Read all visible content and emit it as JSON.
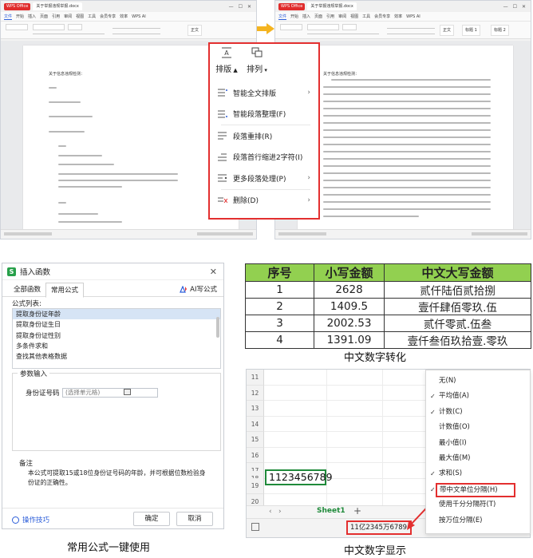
{
  "writer": {
    "app_logo": "WPS Office",
    "tab_label": "关于举报违规举报.docx",
    "menus": [
      "文件",
      "开始",
      "插入",
      "页面",
      "引用",
      "审阅",
      "视图",
      "工具",
      "会员专享",
      "效率",
      "WPS AI"
    ],
    "style_chips": [
      "正文",
      "标题 1",
      "标题 2"
    ],
    "doc_heading_left": "关于信息违规检测：",
    "doc_heading_right": "关于信息违规检测："
  },
  "format_popup": {
    "tool_layout": "排版",
    "tool_arrange": "排列",
    "items": [
      {
        "label": "智能全文排版",
        "icon": "smart-layout-icon",
        "submenu": true
      },
      {
        "label": "智能段落整理(F)",
        "icon": "smart-paragraph-icon",
        "submenu": false
      },
      {
        "label": "段落重排(R)",
        "icon": "paragraph-reflow-icon",
        "submenu": false
      },
      {
        "label": "段落首行缩进2字符(I)",
        "icon": "indent-icon",
        "submenu": false
      },
      {
        "label": "更多段落处理(P)",
        "icon": "more-paragraph-icon",
        "submenu": true
      },
      {
        "label": "删除(D)",
        "icon": "delete-icon",
        "submenu": true
      }
    ],
    "border_color": "#e32f2f"
  },
  "insert_function": {
    "title": "插入函数",
    "tabs": [
      "全部函数",
      "常用公式"
    ],
    "active_tab": "常用公式",
    "ai_button": "AI写公式",
    "list_label": "公式列表:",
    "formulas": [
      "提取身份证年龄",
      "提取身份证生日",
      "提取身份证性别",
      "多条件求和",
      "查找其他表格数据"
    ],
    "selected_formula": "提取身份证年龄",
    "params_label": "参数输入",
    "id_field_label": "身份证号码",
    "id_field_placeholder": "(选择单元格)",
    "note_title": "备注",
    "note_body": "本公式可提取15或18位身份证号码的年龄，并可根据位数检验身份证的正确性。",
    "tips_label": "操作技巧",
    "ok_label": "确定",
    "cancel_label": "取消",
    "caption": "常用公式一键使用"
  },
  "number_table": {
    "headers": [
      "序号",
      "小写金额",
      "中文大写金额"
    ],
    "rows": [
      [
        "1",
        "2628",
        "贰仟陆佰贰拾捌"
      ],
      [
        "2",
        "1409.5",
        "壹仟肆佰零玖.伍"
      ],
      [
        "3",
        "2002.53",
        "贰仟零贰.伍叁"
      ],
      [
        "4",
        "1391.09",
        "壹仟叁佰玖拾壹.零玖"
      ]
    ],
    "header_bg": "#92d050",
    "caption": "中文数字转化"
  },
  "spreadsheet": {
    "row_numbers": [
      "11",
      "12",
      "13",
      "14",
      "15",
      "16",
      "17",
      "18",
      "19",
      "20",
      "21"
    ],
    "cell_value": "1123456789",
    "sheet_tab": "Sheet1",
    "status_value": "11亿2345万6789",
    "context_menu": [
      {
        "label": "无(N)",
        "checked": false
      },
      {
        "label": "平均值(A)",
        "checked": true
      },
      {
        "label": "计数(C)",
        "checked": true
      },
      {
        "label": "计数值(O)",
        "checked": false
      },
      {
        "label": "最小值(I)",
        "checked": false
      },
      {
        "label": "最大值(M)",
        "checked": false
      },
      {
        "label": "求和(S)",
        "checked": true
      },
      {
        "label": "带中文单位分隔(H)",
        "checked": true
      },
      {
        "label": "使用千分分隔符(T)",
        "checked": false
      },
      {
        "label": "按万位分隔(E)",
        "checked": false
      }
    ],
    "highlight_color": "#e32f2f",
    "selected_cell_border": "#1f8a3a",
    "caption": "中文数字显示"
  }
}
